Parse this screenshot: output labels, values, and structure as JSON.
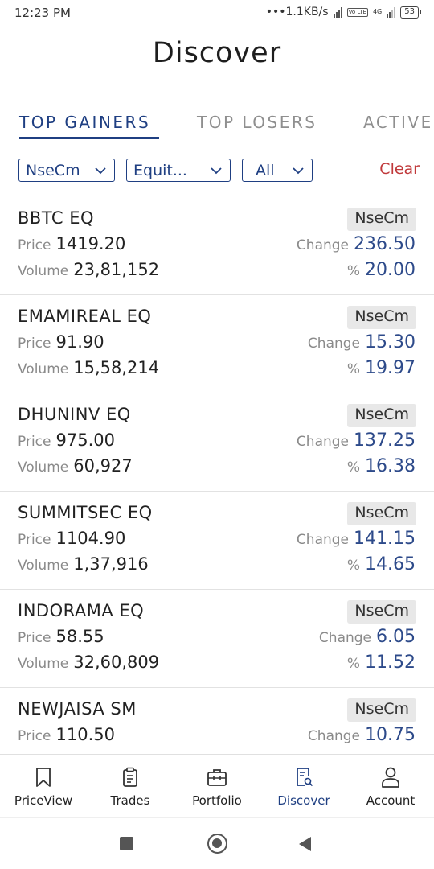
{
  "status_bar": {
    "time": "12:23 PM",
    "network_speed": "•••1.1KB/s",
    "volte": "Vo LTE",
    "network_type": "4G",
    "battery": "53"
  },
  "page": {
    "title": "Discover"
  },
  "tabs": [
    {
      "label": "TOP GAINERS",
      "active": true
    },
    {
      "label": "TOP LOSERS",
      "active": false
    },
    {
      "label": "ACTIVE",
      "active": false
    }
  ],
  "filters": {
    "exchange": "NseCm",
    "segment": "Equit...",
    "group": "All",
    "clear_label": "Clear"
  },
  "labels": {
    "price": "Price",
    "volume": "Volume",
    "change": "Change",
    "percent": "%"
  },
  "stocks": [
    {
      "symbol": "BBTC EQ",
      "exchange": "NseCm",
      "price": "1419.20",
      "volume": "23,81,152",
      "change": "236.50",
      "percent": "20.00"
    },
    {
      "symbol": "EMAMIREAL EQ",
      "exchange": "NseCm",
      "price": "91.90",
      "volume": "15,58,214",
      "change": "15.30",
      "percent": "19.97"
    },
    {
      "symbol": "DHUNINV EQ",
      "exchange": "NseCm",
      "price": "975.00",
      "volume": "60,927",
      "change": "137.25",
      "percent": "16.38"
    },
    {
      "symbol": "SUMMITSEC EQ",
      "exchange": "NseCm",
      "price": "1104.90",
      "volume": "1,37,916",
      "change": "141.15",
      "percent": "14.65"
    },
    {
      "symbol": "INDORAMA EQ",
      "exchange": "NseCm",
      "price": "58.55",
      "volume": "32,60,809",
      "change": "6.05",
      "percent": "11.52"
    },
    {
      "symbol": "NEWJAISA SM",
      "exchange": "NseCm",
      "price": "110.50",
      "volume": "",
      "change": "10.75",
      "percent": ""
    }
  ],
  "bottom_nav": [
    {
      "label": "PriceView",
      "icon": "bookmark-icon",
      "active": false
    },
    {
      "label": "Trades",
      "icon": "clipboard-icon",
      "active": false
    },
    {
      "label": "Portfolio",
      "icon": "briefcase-icon",
      "active": false
    },
    {
      "label": "Discover",
      "icon": "document-search-icon",
      "active": true
    },
    {
      "label": "Account",
      "icon": "person-icon",
      "active": false
    }
  ],
  "colors": {
    "accent": "#1f3f82",
    "clear": "#c0393b",
    "value": "#2d4a8a",
    "muted": "#8a8a8a"
  }
}
